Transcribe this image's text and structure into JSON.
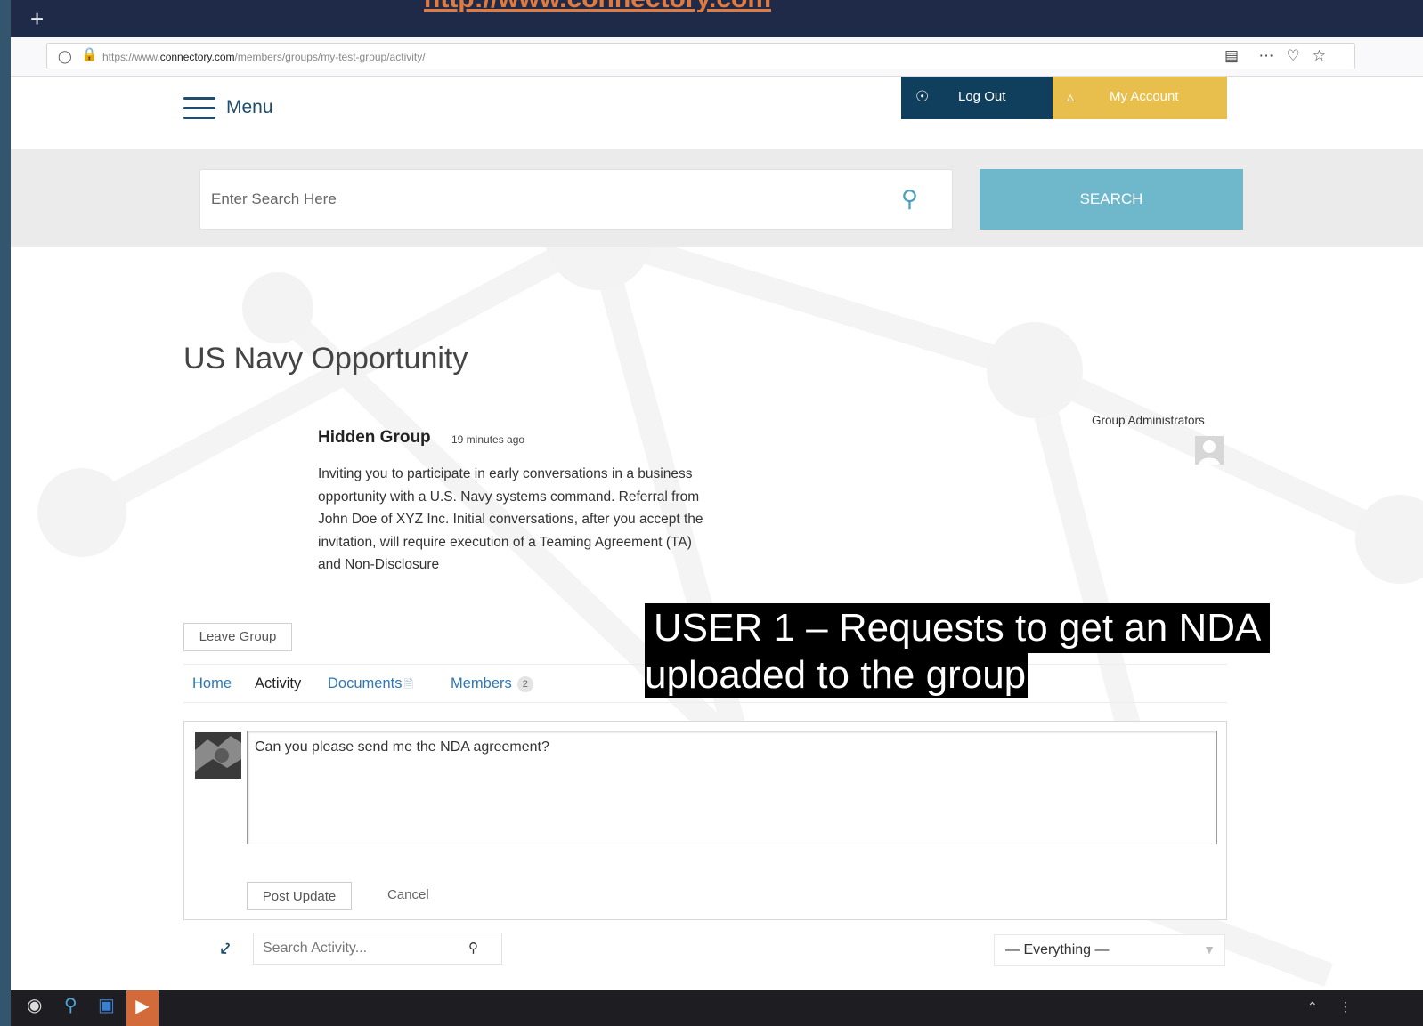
{
  "slide": {
    "title_link": "http://www.connectory.com",
    "overlay_line1": "USER 1 – Requests to get an NDA",
    "overlay_line2": "uploaded to the group"
  },
  "browser": {
    "new_tab_symbol": "+",
    "url_prefix": "https://www.",
    "url_domain": "connectory.com",
    "url_path": "/members/groups/my-test-group/activity/",
    "toolbar_icons": [
      "reader-icon",
      "more-icon",
      "pocket-icon",
      "bookmark-star-icon"
    ]
  },
  "header": {
    "menu_label": "Menu",
    "logout_label": "Log Out",
    "my_account_label": "My Account"
  },
  "search": {
    "placeholder": "Enter Search Here",
    "button_label": "SEARCH"
  },
  "group": {
    "title": "US Navy Opportunity",
    "type": "Hidden Group",
    "time_ago": "19 minutes ago",
    "description": "Inviting you to participate in early conversations in a business opportunity with a U.S. Navy systems command. Referral from John Doe of XYZ Inc. Initial conversations, after you accept the invitation, will require execution of a Teaming Agreement (TA) and Non-Disclosure",
    "admins_label": "Group Administrators",
    "leave_label": "Leave Group"
  },
  "tabs": [
    {
      "label": "Home"
    },
    {
      "label": "Activity"
    },
    {
      "label": "Documents"
    },
    {
      "label": "Members",
      "count": "2"
    }
  ],
  "post": {
    "text": "Can you please send me the NDA agreement?",
    "post_label": "Post Update",
    "cancel_label": "Cancel"
  },
  "activity": {
    "search_placeholder": "Search Activity...",
    "filter_value": "— Everything —"
  },
  "colors": {
    "logout_bg": "#0f3f5c",
    "my_account_bg": "#e8be4c",
    "search_button_bg": "#6fb8cc",
    "link": "#2d78b4",
    "title_link": "#e07a3e"
  }
}
